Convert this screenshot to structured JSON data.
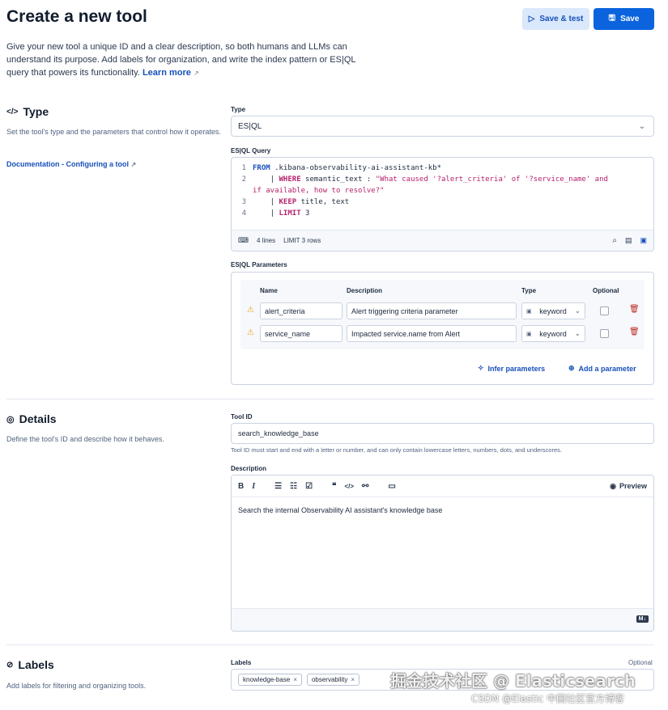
{
  "header": {
    "title": "Create a new tool",
    "save_test_label": "Save & test",
    "save_label": "Save"
  },
  "intro": {
    "text": "Give your new tool a unique ID and a clear description, so both humans and LLMs can understand its purpose. Add labels for organization, and write the index pattern or ES|QL query that powers its functionality.",
    "learn_more": "Learn more"
  },
  "type_section": {
    "title": "Type",
    "description": "Set the tool's type and the parameters that control how it operates.",
    "doc_link": "Documentation - Configuring a tool",
    "type_label": "Type",
    "type_value": "ES|QL",
    "query_label": "ES|QL Query",
    "query_lines": [
      {
        "num": "1",
        "parts": [
          [
            "kw",
            "FROM"
          ],
          [
            "plain",
            " .kibana-observability-ai-assistant-kb*"
          ]
        ]
      },
      {
        "num": "2",
        "parts": [
          [
            "plain",
            "    | "
          ],
          [
            "kw2",
            "WHERE"
          ],
          [
            "plain",
            " semantic_text : "
          ],
          [
            "str",
            "\"What caused '?alert_criteria' of '?service_name' and"
          ]
        ]
      },
      {
        "num": "",
        "parts": [
          [
            "str",
            "if available, how to resolve?\""
          ]
        ]
      },
      {
        "num": "3",
        "parts": [
          [
            "plain",
            "    | "
          ],
          [
            "kw2",
            "KEEP"
          ],
          [
            "plain",
            " title, text"
          ]
        ]
      },
      {
        "num": "4",
        "parts": [
          [
            "plain",
            "    | "
          ],
          [
            "kw2",
            "LIMIT"
          ],
          [
            "plain",
            " 3"
          ]
        ]
      }
    ],
    "query_footer_lines": "4 lines",
    "query_footer_limit": "LIMIT 3 rows",
    "params_label": "ES|QL Parameters",
    "params_headers": {
      "name": "Name",
      "description": "Description",
      "type": "Type",
      "optional": "Optional"
    },
    "params": [
      {
        "name": "alert_criteria",
        "description": "Alert triggering criteria parameter",
        "type": "keyword"
      },
      {
        "name": "service_name",
        "description": "Impacted service.name from Alert",
        "type": "keyword"
      }
    ],
    "infer_label": "Infer parameters",
    "add_param_label": "Add a parameter"
  },
  "details_section": {
    "title": "Details",
    "description": "Define the tool's ID and describe how it behaves.",
    "tool_id_label": "Tool ID",
    "tool_id_value": "search_knowledge_base",
    "tool_id_help": "Tool ID must start and end with a letter or number, and can only contain lowercase letters, numbers, dots, and underscores.",
    "desc_label": "Description",
    "preview_label": "Preview",
    "desc_value": "Search the internal Observability AI assistant's knowledge base",
    "md_badge": "M↓"
  },
  "labels_section": {
    "title": "Labels",
    "description": "Add labels for filtering and organizing tools.",
    "labels_label": "Labels",
    "optional_label": "Optional",
    "tags": [
      "knowledge-base",
      "observability"
    ]
  },
  "watermark": {
    "line1": "掘金技术社区 @ Elasticsearch",
    "line2": "CSDN @Elastic 中国社区官方博客"
  },
  "colors": {
    "primary": "#0b64dd",
    "link": "#1750ba",
    "warning": "#f2c94c",
    "danger": "#bd271e"
  }
}
